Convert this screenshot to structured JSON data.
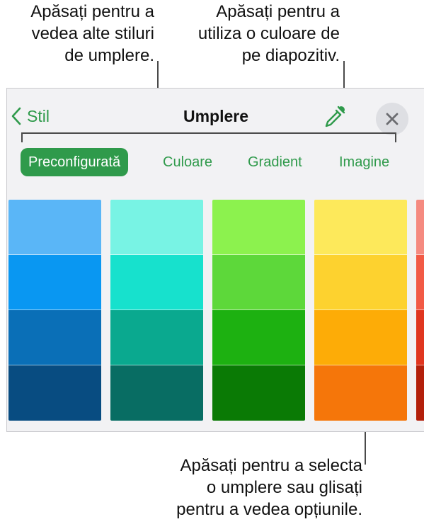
{
  "callouts": {
    "fill_styles": [
      "Apăsați pentru a",
      "vedea alte stiluri",
      "de umplere."
    ],
    "slide_color": [
      "Apăsați pentru a",
      "utiliza o culoare de",
      "pe diapozitiv."
    ],
    "select_fill": [
      "Apăsați pentru a selecta",
      "o umplere sau glisați",
      "pentru a vedea opțiunile."
    ]
  },
  "header": {
    "back_label": "Stil",
    "title": "Umplere",
    "eyedropper_icon": "eyedropper-icon",
    "close_icon": "close-icon"
  },
  "tabs": [
    {
      "label": "Preconfigurată",
      "active": true
    },
    {
      "label": "Culoare",
      "active": false
    },
    {
      "label": "Gradient",
      "active": false
    },
    {
      "label": "Imagine",
      "active": false
    }
  ],
  "accent_color": "#2f9a4b",
  "swatch_columns": [
    [
      "#5ab6f7",
      "#0997f2",
      "#0a6fb7",
      "#084c81"
    ],
    [
      "#78f3e4",
      "#17e1cd",
      "#0aa98f",
      "#086d63"
    ],
    [
      "#8cf24e",
      "#5dd83a",
      "#1db111",
      "#0a7a05"
    ],
    [
      "#fde95b",
      "#fdd22f",
      "#fdac07",
      "#f5760a"
    ],
    [
      "#f58a80",
      "#f25a45",
      "#e0361f",
      "#b3200b"
    ]
  ]
}
